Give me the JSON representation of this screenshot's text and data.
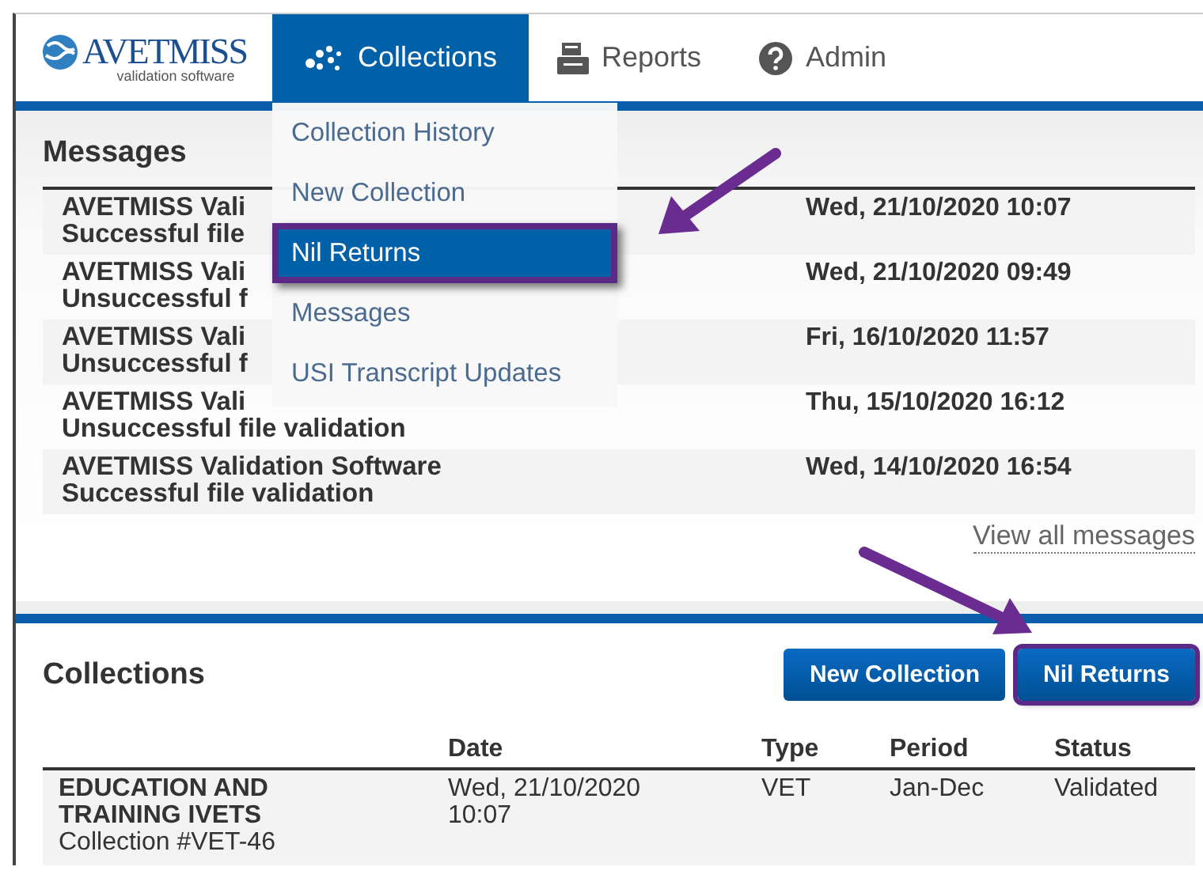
{
  "logo": {
    "name": "AVETMISS",
    "tagline": "validation software"
  },
  "nav": [
    {
      "label": "Collections",
      "selected": true
    },
    {
      "label": "Reports",
      "selected": false
    },
    {
      "label": "Admin",
      "selected": false
    }
  ],
  "dropdown": [
    {
      "label": "Collection History",
      "selected": false,
      "highlighted": false
    },
    {
      "label": "New Collection",
      "selected": false,
      "highlighted": false
    },
    {
      "label": "Nil Returns",
      "selected": true,
      "highlighted": true
    },
    {
      "label": "Messages",
      "selected": false,
      "highlighted": false
    },
    {
      "label": "USI Transcript Updates",
      "selected": false,
      "highlighted": false
    }
  ],
  "messages": {
    "title": "Messages",
    "rows": [
      {
        "title": "AVETMISS Vali",
        "detail": "Successful file",
        "date": "Wed, 21/10/2020 10:07"
      },
      {
        "title": "AVETMISS Vali",
        "detail": "Unsuccessful f",
        "date": "Wed, 21/10/2020 09:49"
      },
      {
        "title": "AVETMISS Vali",
        "detail": "Unsuccessful f",
        "date": "Fri, 16/10/2020 11:57"
      },
      {
        "title": "AVETMISS Vali",
        "detail": "Unsuccessful file validation",
        "date": "Thu, 15/10/2020 16:12"
      },
      {
        "title": "AVETMISS Validation Software",
        "detail": "Successful file validation",
        "date": "Wed, 14/10/2020 16:54"
      }
    ],
    "link": "View all messages"
  },
  "collections": {
    "title": "Collections",
    "buttons": [
      {
        "label": "New Collection",
        "highlighted": false
      },
      {
        "label": "Nil Returns",
        "highlighted": true
      }
    ],
    "columns": [
      "Date",
      "Type",
      "Period",
      "Status"
    ],
    "rows": [
      {
        "name": "EDUCATION AND TRAINING IVETS",
        "id": "Collection #VET-46",
        "date": "Wed, 21/10/2020 10:07",
        "type": "VET",
        "period": "Jan-Dec",
        "status": "Validated"
      }
    ]
  }
}
